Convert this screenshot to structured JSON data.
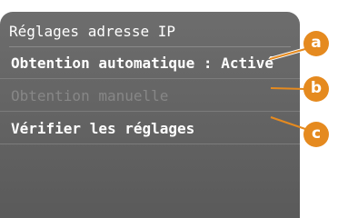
{
  "screen": {
    "title": "Réglages adresse IP",
    "items": [
      {
        "label": "Obtention automatique : Activé",
        "enabled": true
      },
      {
        "label": "Obtention manuelle",
        "enabled": false
      },
      {
        "label": "Vérifier les réglages",
        "enabled": true
      }
    ]
  },
  "callouts": [
    "a",
    "b",
    "c"
  ],
  "colors": {
    "screen_bg": "#666666",
    "callout": "#e58a1f",
    "disabled_text": "#878787"
  }
}
